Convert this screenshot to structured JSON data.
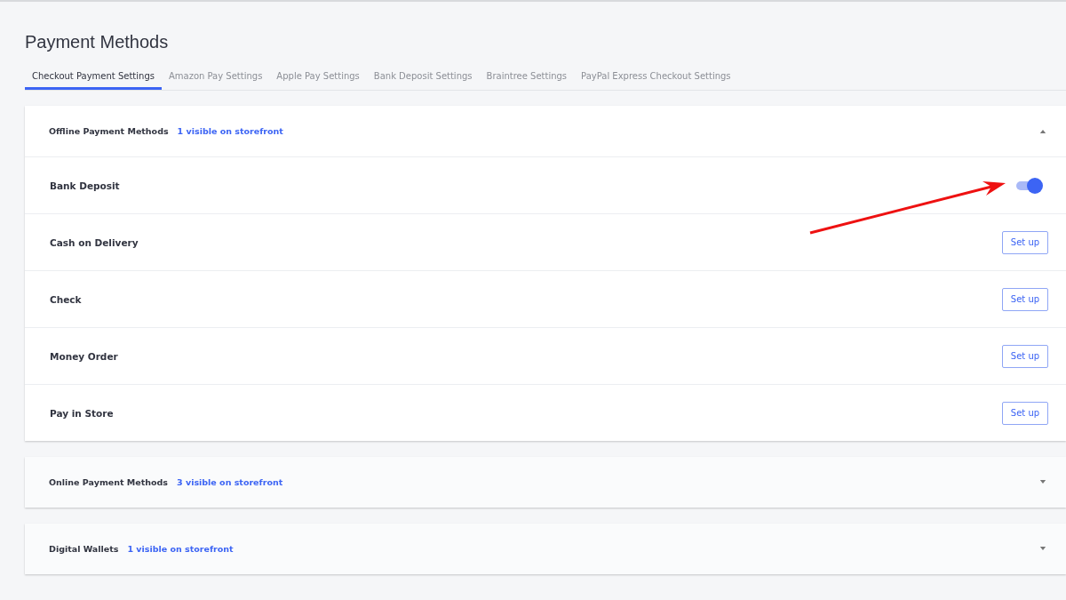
{
  "page_title": "Payment Methods",
  "tabs": [
    {
      "label": "Checkout Payment Settings",
      "selected": true
    },
    {
      "label": "Amazon Pay Settings",
      "selected": false
    },
    {
      "label": "Apple Pay Settings",
      "selected": false
    },
    {
      "label": "Bank Deposit Settings",
      "selected": false
    },
    {
      "label": "Braintree Settings",
      "selected": false
    },
    {
      "label": "PayPal Express Checkout Settings",
      "selected": false
    }
  ],
  "sections": [
    {
      "title": "Offline Payment Methods",
      "visible_count": "1 visible on storefront",
      "expanded": true,
      "methods": [
        {
          "name": "Bank Deposit",
          "kind": "toggle",
          "on": true
        },
        {
          "name": "Cash on Delivery",
          "kind": "button",
          "button": "Set up"
        },
        {
          "name": "Check",
          "kind": "button",
          "button": "Set up"
        },
        {
          "name": "Money Order",
          "kind": "button",
          "button": "Set up"
        },
        {
          "name": "Pay in Store",
          "kind": "button",
          "button": "Set up"
        }
      ]
    },
    {
      "title": "Online Payment Methods",
      "visible_count": "3 visible on storefront",
      "expanded": false
    },
    {
      "title": "Digital Wallets",
      "visible_count": "1 visible on storefront",
      "expanded": false
    }
  ]
}
